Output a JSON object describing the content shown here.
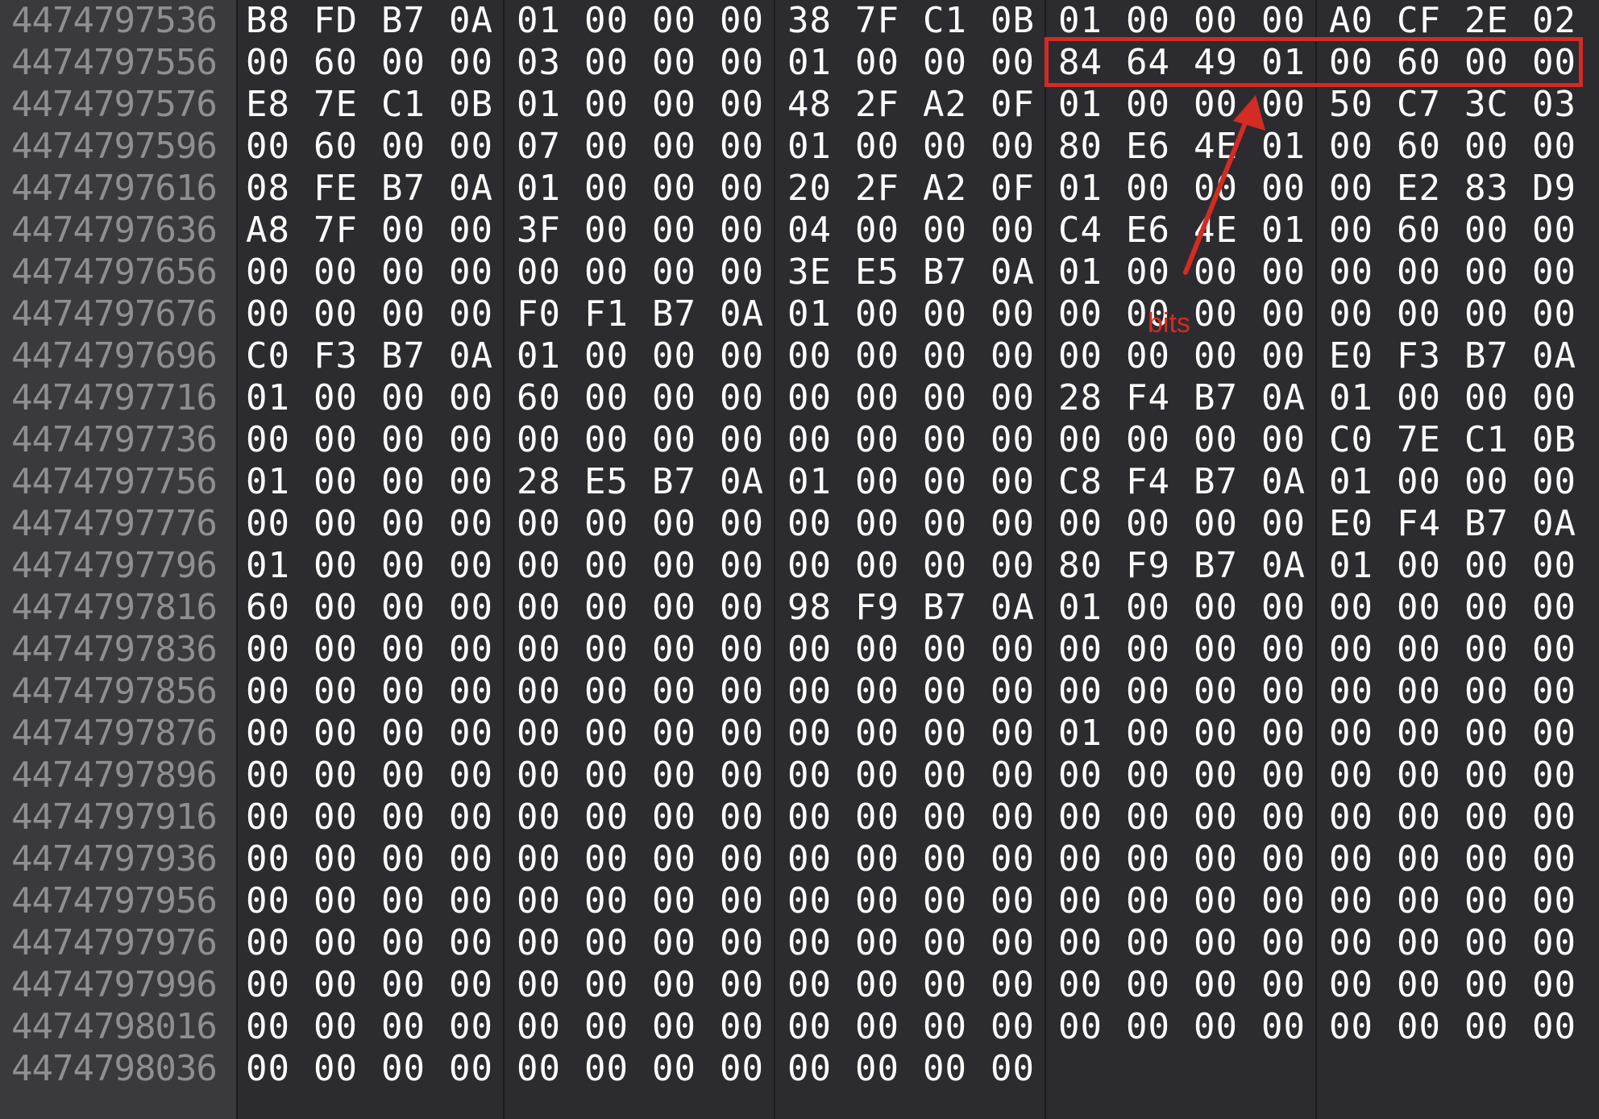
{
  "hexview": {
    "rows": [
      {
        "address": "4474797536",
        "bytes": [
          "B8",
          "FD",
          "B7",
          "0A",
          "01",
          "00",
          "00",
          "00",
          "38",
          "7F",
          "C1",
          "0B",
          "01",
          "00",
          "00",
          "00",
          "A0",
          "CF",
          "2E",
          "02"
        ]
      },
      {
        "address": "4474797556",
        "bytes": [
          "00",
          "60",
          "00",
          "00",
          "03",
          "00",
          "00",
          "00",
          "01",
          "00",
          "00",
          "00",
          "84",
          "64",
          "49",
          "01",
          "00",
          "60",
          "00",
          "00"
        ]
      },
      {
        "address": "4474797576",
        "bytes": [
          "E8",
          "7E",
          "C1",
          "0B",
          "01",
          "00",
          "00",
          "00",
          "48",
          "2F",
          "A2",
          "0F",
          "01",
          "00",
          "00",
          "00",
          "50",
          "C7",
          "3C",
          "03"
        ]
      },
      {
        "address": "4474797596",
        "bytes": [
          "00",
          "60",
          "00",
          "00",
          "07",
          "00",
          "00",
          "00",
          "01",
          "00",
          "00",
          "00",
          "80",
          "E6",
          "4E",
          "01",
          "00",
          "60",
          "00",
          "00"
        ]
      },
      {
        "address": "4474797616",
        "bytes": [
          "08",
          "FE",
          "B7",
          "0A",
          "01",
          "00",
          "00",
          "00",
          "20",
          "2F",
          "A2",
          "0F",
          "01",
          "00",
          "00",
          "00",
          "00",
          "E2",
          "83",
          "D9"
        ]
      },
      {
        "address": "4474797636",
        "bytes": [
          "A8",
          "7F",
          "00",
          "00",
          "3F",
          "00",
          "00",
          "00",
          "04",
          "00",
          "00",
          "00",
          "C4",
          "E6",
          "4E",
          "01",
          "00",
          "60",
          "00",
          "00"
        ]
      },
      {
        "address": "4474797656",
        "bytes": [
          "00",
          "00",
          "00",
          "00",
          "00",
          "00",
          "00",
          "00",
          "3E",
          "E5",
          "B7",
          "0A",
          "01",
          "00",
          "00",
          "00",
          "00",
          "00",
          "00",
          "00"
        ]
      },
      {
        "address": "4474797676",
        "bytes": [
          "00",
          "00",
          "00",
          "00",
          "F0",
          "F1",
          "B7",
          "0A",
          "01",
          "00",
          "00",
          "00",
          "00",
          "00",
          "00",
          "00",
          "00",
          "00",
          "00",
          "00"
        ]
      },
      {
        "address": "4474797696",
        "bytes": [
          "C0",
          "F3",
          "B7",
          "0A",
          "01",
          "00",
          "00",
          "00",
          "00",
          "00",
          "00",
          "00",
          "00",
          "00",
          "00",
          "00",
          "E0",
          "F3",
          "B7",
          "0A"
        ]
      },
      {
        "address": "4474797716",
        "bytes": [
          "01",
          "00",
          "00",
          "00",
          "60",
          "00",
          "00",
          "00",
          "00",
          "00",
          "00",
          "00",
          "28",
          "F4",
          "B7",
          "0A",
          "01",
          "00",
          "00",
          "00"
        ]
      },
      {
        "address": "4474797736",
        "bytes": [
          "00",
          "00",
          "00",
          "00",
          "00",
          "00",
          "00",
          "00",
          "00",
          "00",
          "00",
          "00",
          "00",
          "00",
          "00",
          "00",
          "C0",
          "7E",
          "C1",
          "0B"
        ]
      },
      {
        "address": "4474797756",
        "bytes": [
          "01",
          "00",
          "00",
          "00",
          "28",
          "E5",
          "B7",
          "0A",
          "01",
          "00",
          "00",
          "00",
          "C8",
          "F4",
          "B7",
          "0A",
          "01",
          "00",
          "00",
          "00"
        ]
      },
      {
        "address": "4474797776",
        "bytes": [
          "00",
          "00",
          "00",
          "00",
          "00",
          "00",
          "00",
          "00",
          "00",
          "00",
          "00",
          "00",
          "00",
          "00",
          "00",
          "00",
          "E0",
          "F4",
          "B7",
          "0A"
        ]
      },
      {
        "address": "4474797796",
        "bytes": [
          "01",
          "00",
          "00",
          "00",
          "00",
          "00",
          "00",
          "00",
          "00",
          "00",
          "00",
          "00",
          "80",
          "F9",
          "B7",
          "0A",
          "01",
          "00",
          "00",
          "00"
        ]
      },
      {
        "address": "4474797816",
        "bytes": [
          "60",
          "00",
          "00",
          "00",
          "00",
          "00",
          "00",
          "00",
          "98",
          "F9",
          "B7",
          "0A",
          "01",
          "00",
          "00",
          "00",
          "00",
          "00",
          "00",
          "00"
        ]
      },
      {
        "address": "4474797836",
        "bytes": [
          "00",
          "00",
          "00",
          "00",
          "00",
          "00",
          "00",
          "00",
          "00",
          "00",
          "00",
          "00",
          "00",
          "00",
          "00",
          "00",
          "00",
          "00",
          "00",
          "00"
        ]
      },
      {
        "address": "4474797856",
        "bytes": [
          "00",
          "00",
          "00",
          "00",
          "00",
          "00",
          "00",
          "00",
          "00",
          "00",
          "00",
          "00",
          "00",
          "00",
          "00",
          "00",
          "00",
          "00",
          "00",
          "00"
        ]
      },
      {
        "address": "4474797876",
        "bytes": [
          "00",
          "00",
          "00",
          "00",
          "00",
          "00",
          "00",
          "00",
          "00",
          "00",
          "00",
          "00",
          "01",
          "00",
          "00",
          "00",
          "00",
          "00",
          "00",
          "00"
        ]
      },
      {
        "address": "4474797896",
        "bytes": [
          "00",
          "00",
          "00",
          "00",
          "00",
          "00",
          "00",
          "00",
          "00",
          "00",
          "00",
          "00",
          "00",
          "00",
          "00",
          "00",
          "00",
          "00",
          "00",
          "00"
        ]
      },
      {
        "address": "4474797916",
        "bytes": [
          "00",
          "00",
          "00",
          "00",
          "00",
          "00",
          "00",
          "00",
          "00",
          "00",
          "00",
          "00",
          "00",
          "00",
          "00",
          "00",
          "00",
          "00",
          "00",
          "00"
        ]
      },
      {
        "address": "4474797936",
        "bytes": [
          "00",
          "00",
          "00",
          "00",
          "00",
          "00",
          "00",
          "00",
          "00",
          "00",
          "00",
          "00",
          "00",
          "00",
          "00",
          "00",
          "00",
          "00",
          "00",
          "00"
        ]
      },
      {
        "address": "4474797956",
        "bytes": [
          "00",
          "00",
          "00",
          "00",
          "00",
          "00",
          "00",
          "00",
          "00",
          "00",
          "00",
          "00",
          "00",
          "00",
          "00",
          "00",
          "00",
          "00",
          "00",
          "00"
        ]
      },
      {
        "address": "4474797976",
        "bytes": [
          "00",
          "00",
          "00",
          "00",
          "00",
          "00",
          "00",
          "00",
          "00",
          "00",
          "00",
          "00",
          "00",
          "00",
          "00",
          "00",
          "00",
          "00",
          "00",
          "00"
        ]
      },
      {
        "address": "4474797996",
        "bytes": [
          "00",
          "00",
          "00",
          "00",
          "00",
          "00",
          "00",
          "00",
          "00",
          "00",
          "00",
          "00",
          "00",
          "00",
          "00",
          "00",
          "00",
          "00",
          "00",
          "00"
        ]
      },
      {
        "address": "4474798016",
        "bytes": [
          "00",
          "00",
          "00",
          "00",
          "00",
          "00",
          "00",
          "00",
          "00",
          "00",
          "00",
          "00",
          "00",
          "00",
          "00",
          "00",
          "00",
          "00",
          "00",
          "00"
        ]
      },
      {
        "address": "4474798036",
        "bytes": [
          "00",
          "00",
          "00",
          "00",
          "00",
          "00",
          "00",
          "00",
          "00",
          "00",
          "00",
          "00"
        ]
      }
    ]
  },
  "annotation": {
    "label": "bits",
    "color": "#d42b22"
  },
  "colors": {
    "background": "#2c2c30",
    "gutter": "#3a3a3d",
    "address_text": "#8e8e93",
    "byte_text": "#ffffff"
  }
}
